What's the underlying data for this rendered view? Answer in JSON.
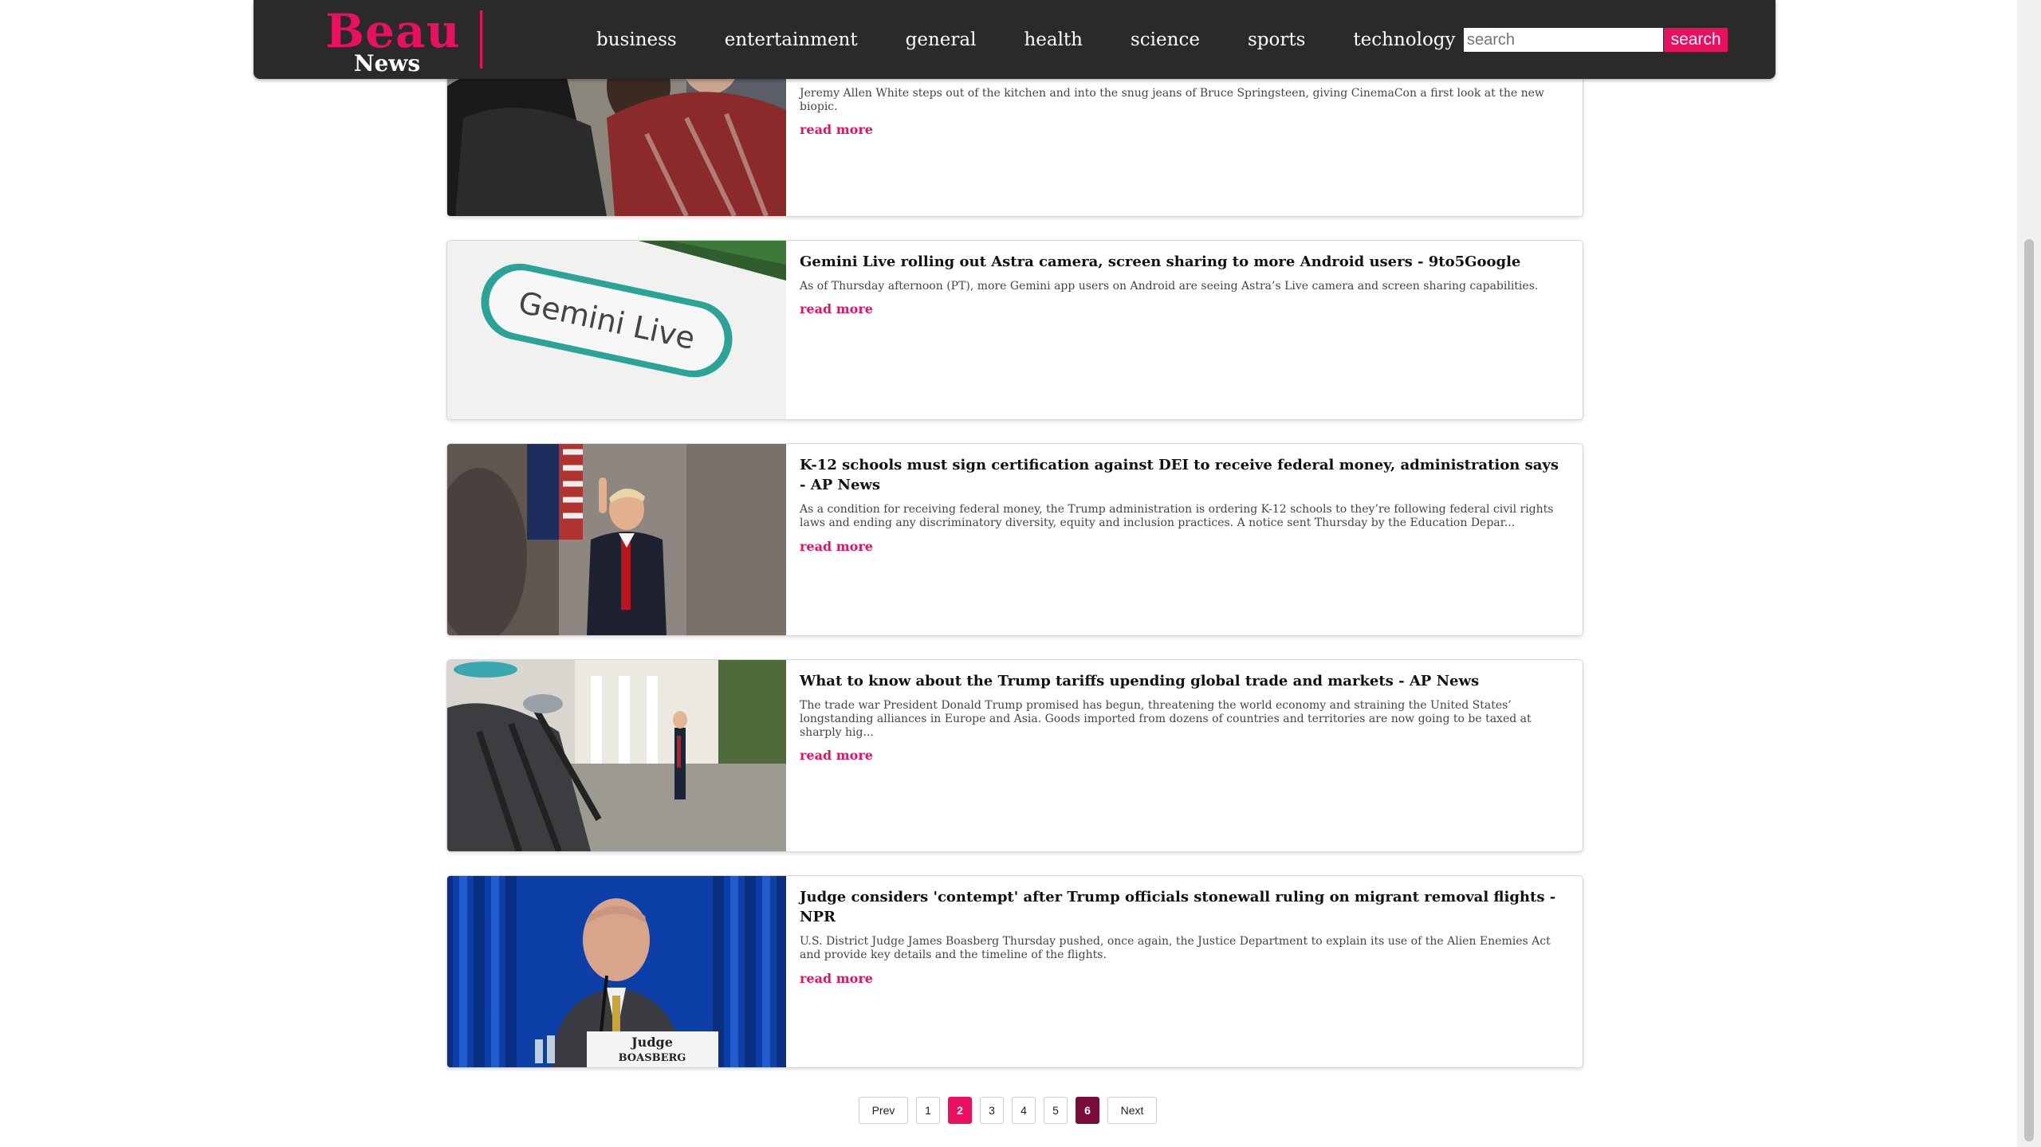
{
  "header": {
    "logo_line1": "Beau",
    "logo_line2": "News",
    "nav": [
      "business",
      "entertainment",
      "general",
      "health",
      "science",
      "sports",
      "technology"
    ],
    "search_placeholder": "search",
    "search_button": "search"
  },
  "articles": [
    {
      "title": "",
      "description": "Jeremy Allen White steps out of the kitchen and into the snug jeans of Bruce Springsteen, giving CinemaCon a first look at the new biopic.",
      "link_label": "read more"
    },
    {
      "title": "Gemini Live rolling out Astra camera, screen sharing to more Android users - 9to5Google",
      "description": "As of Thursday afternoon (PT), more Gemini app users on Android are seeing Astra’s Live camera and screen sharing capabilities.",
      "link_label": "read more",
      "image_text": "Gemini Live"
    },
    {
      "title": "K-12 schools must sign certification against DEI to receive federal money, administration says - AP News",
      "description": "As a condition for receiving federal money, the Trump administration is ordering K-12 schools to they’re following federal civil rights laws and ending any discriminatory diversity, equity and inclusion practices. A notice sent Thursday by the Education Depar...",
      "link_label": "read more"
    },
    {
      "title": "What to know about the Trump tariffs upending global trade and markets - AP News",
      "description": "The trade war President Donald Trump promised has begun, threatening the world economy and straining the United States’ longstanding alliances in Europe and Asia. Goods imported from dozens of countries and territories are now going to be taxed at sharply hig...",
      "link_label": "read more"
    },
    {
      "title": "Judge considers 'contempt' after Trump officials stonewall ruling on migrant removal flights - NPR",
      "description": "U.S. District Judge James Boasberg Thursday pushed, once again, the Justice Department to explain its use of the Alien Enemies Act and provide key details and the timeline of the flights.",
      "link_label": "read more",
      "image_text_line1": "Judge",
      "image_text_line2": "BOASBERG"
    }
  ],
  "pagination": {
    "prev": "Prev",
    "pages": [
      "1",
      "2",
      "3",
      "4",
      "5",
      "6"
    ],
    "next": "Next",
    "current": "2"
  },
  "colors": {
    "accent": "#e8105f",
    "header_bg": "#2a2a2a",
    "last_page": "#7a0c3a"
  }
}
